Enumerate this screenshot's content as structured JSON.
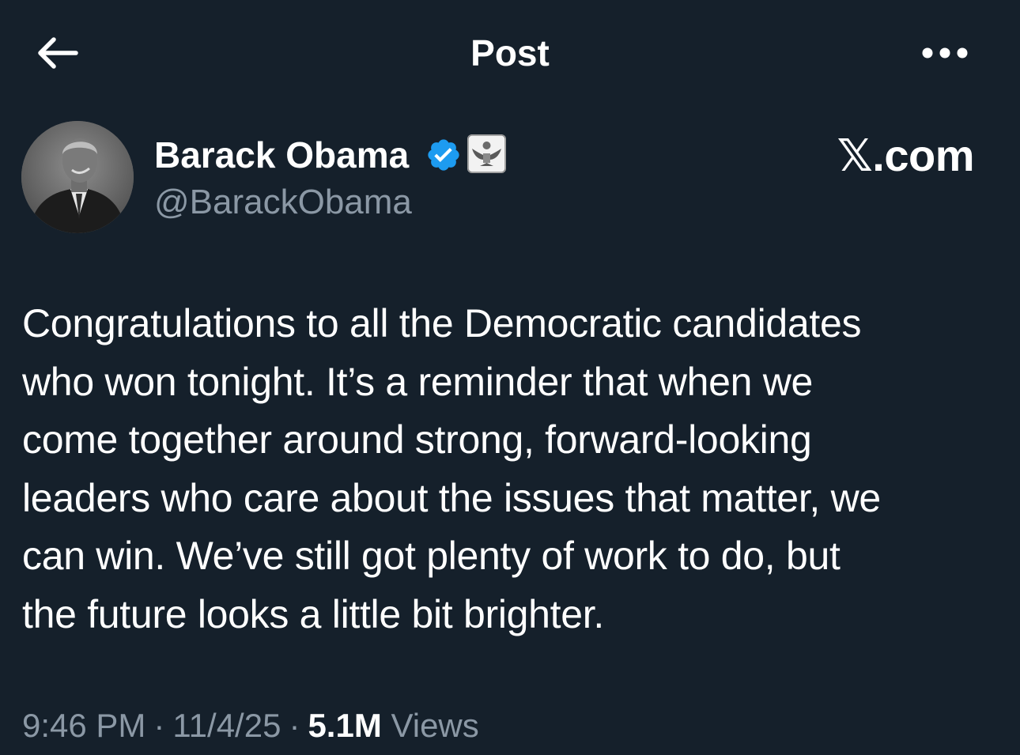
{
  "header": {
    "title": "Post",
    "back_icon": "back-arrow-icon",
    "more_icon": "more-dots-icon"
  },
  "author": {
    "name": "Barack Obama",
    "handle": "@BarackObama",
    "verified_icon": "verified-badge-icon",
    "verified_color": "#1d9bf0",
    "affiliation_icon": "government-seal-icon"
  },
  "watermark": {
    "text": "𝕏.com"
  },
  "tweet": {
    "text": "Congratulations to all the Democratic candidates\nwho won tonight. It’s a reminder that when we\ncome together around strong, forward-looking\nleaders who care about the issues that matter, we\ncan win. We’ve still got plenty of work to do, but\nthe future looks a little bit brighter.",
    "time": "9:46 PM",
    "separator": "·",
    "date": "11/4/25",
    "views_count": "5.1M",
    "views_label": "Views"
  },
  "colors": {
    "background": "#15202b",
    "text": "#ffffff",
    "muted": "#8b98a5"
  }
}
